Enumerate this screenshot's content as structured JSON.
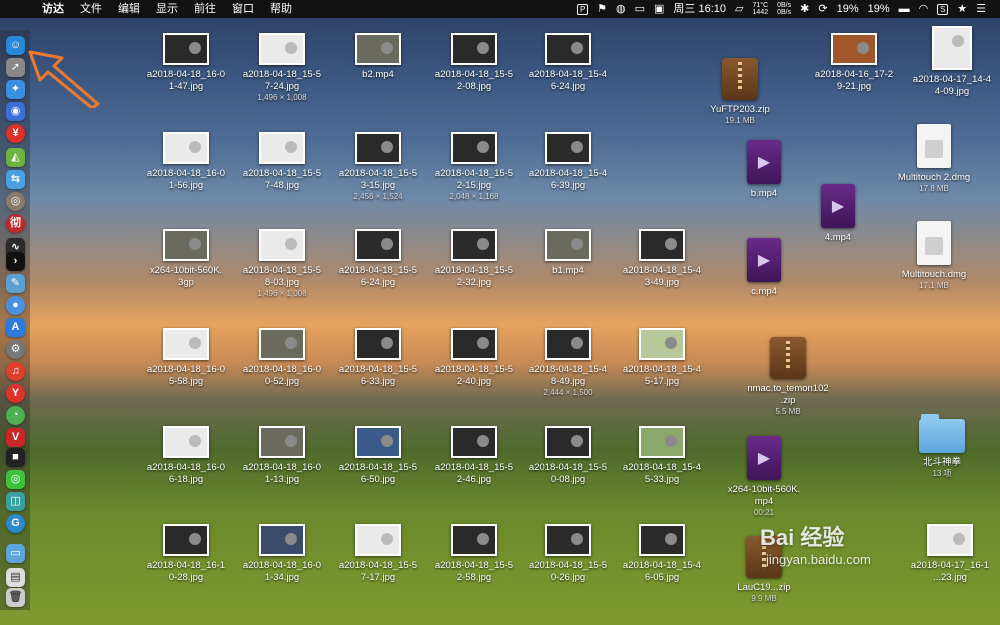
{
  "menubar": {
    "app_name": "访达",
    "menus": [
      "文件",
      "编辑",
      "显示",
      "前往",
      "窗口",
      "帮助"
    ],
    "temp": "71°C",
    "rpm": "1442",
    "net_up": "0B/s",
    "net_down": "0B/s",
    "clock": "周三 16:10",
    "battery_1": "19%",
    "battery_2": "19%"
  },
  "desktop": {
    "row1": [
      {
        "name": "a2018-04-18_16-0\n1-47.jpg",
        "sub": ""
      },
      {
        "name": "a2018-04-18_15-5\n7-24.jpg",
        "sub": "1,496 × 1,008"
      },
      {
        "name": "b2.mp4",
        "sub": ""
      },
      {
        "name": "a2018-04-18_15-5\n2-08.jpg",
        "sub": ""
      },
      {
        "name": "a2018-04-18_15-4\n6-24.jpg",
        "sub": ""
      }
    ],
    "row2": [
      {
        "name": "a2018-04-18_16-0\n1-56.jpg",
        "sub": ""
      },
      {
        "name": "a2018-04-18_15-5\n7-48.jpg",
        "sub": ""
      },
      {
        "name": "a2018-04-18_15-5\n3-15.jpg",
        "sub": "2,456 × 1,524"
      },
      {
        "name": "a2018-04-18_15-5\n2-15.jpg",
        "sub": "2,048 × 1,168"
      },
      {
        "name": "a2018-04-18_15-4\n6-39.jpg",
        "sub": ""
      }
    ],
    "row3": [
      {
        "name": "x264-10bit-560K.\n3gp",
        "sub": ""
      },
      {
        "name": "a2018-04-18_15-5\n8-03.jpg",
        "sub": "1,496 × 1,008"
      },
      {
        "name": "a2018-04-18_15-5\n6-24.jpg",
        "sub": ""
      },
      {
        "name": "a2018-04-18_15-5\n2-32.jpg",
        "sub": ""
      },
      {
        "name": "b1.mp4",
        "sub": ""
      },
      {
        "name": "a2018-04-18_15-4\n3-49.jpg",
        "sub": ""
      }
    ],
    "row4": [
      {
        "name": "a2018-04-18_16-0\n5-58.jpg",
        "sub": ""
      },
      {
        "name": "a2018-04-18_16-0\n0-52.jpg",
        "sub": ""
      },
      {
        "name": "a2018-04-18_15-5\n6-33.jpg",
        "sub": ""
      },
      {
        "name": "a2018-04-18_15-5\n2-40.jpg",
        "sub": ""
      },
      {
        "name": "a2018-04-18_15-4\n8-49.jpg",
        "sub": "2,444 × 1,500"
      },
      {
        "name": "a2018-04-18_15-4\n5-17.jpg",
        "sub": ""
      }
    ],
    "row5": [
      {
        "name": "a2018-04-18_16-0\n6-18.jpg",
        "sub": ""
      },
      {
        "name": "a2018-04-18_16-0\n1-13.jpg",
        "sub": ""
      },
      {
        "name": "a2018-04-18_15-5\n6-50.jpg",
        "sub": ""
      },
      {
        "name": "a2018-04-18_15-5\n2-46.jpg",
        "sub": ""
      },
      {
        "name": "a2018-04-18_15-5\n0-08.jpg",
        "sub": ""
      },
      {
        "name": "a2018-04-18_15-4\n5-33.jpg",
        "sub": ""
      }
    ],
    "row6": [
      {
        "name": "a2018-04-18_16-1\n0-28.jpg",
        "sub": ""
      },
      {
        "name": "a2018-04-18_16-0\n1-34.jpg",
        "sub": ""
      },
      {
        "name": "a2018-04-18_15-5\n7-17.jpg",
        "sub": ""
      },
      {
        "name": "a2018-04-18_15-5\n2-58.jpg",
        "sub": ""
      },
      {
        "name": "a2018-04-18_15-5\n0-26.jpg",
        "sub": ""
      },
      {
        "name": "a2018-04-18_15-4\n6-05.jpg",
        "sub": ""
      }
    ],
    "right": {
      "yuftp": {
        "name": "YuFTP203.zip",
        "sub": "19.1 MB"
      },
      "top_thumb": {
        "name": "a2018-04-16_17-2\n9-21.jpg",
        "sub": ""
      },
      "corner_top": {
        "name": "a2018-04-17_14-4\n4-09.jpg",
        "sub": ""
      },
      "b_mp4": {
        "name": "b.mp4",
        "sub": ""
      },
      "four_mp4": {
        "name": "4.mp4",
        "sub": ""
      },
      "mt2": {
        "name": "Multitouch 2.dmg",
        "sub": "17.8 MB"
      },
      "c_mp4": {
        "name": "c.mp4",
        "sub": ""
      },
      "mt": {
        "name": "Multitouch.dmg",
        "sub": "17.1 MB"
      },
      "nmac": {
        "name": "nmac.to_temon102\n.zip",
        "sub": "5.5 MB"
      },
      "folder": {
        "name": "北斗神拳",
        "sub": "13 项"
      },
      "x264": {
        "name": "x264-10bit-560K.\nmp4",
        "sub": "00:21"
      },
      "lau": {
        "name": "LauC19...zip",
        "sub": "9.9 MB"
      },
      "corner_bottom": {
        "name": "a2018-04-17_16-1\n...23.jpg",
        "sub": ""
      }
    }
  },
  "watermark": {
    "brand": "Bai 经验",
    "url": "jingyan.baidu.com"
  },
  "colors": {
    "accent_arrow": "#f07a2a",
    "dock_finder": "#2a88d8"
  }
}
